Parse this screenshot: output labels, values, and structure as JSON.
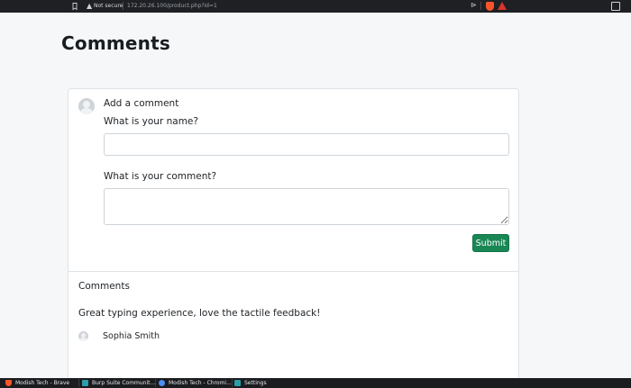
{
  "browser": {
    "security_text": "Not secure",
    "url": "172.20.26.100/product.php?id=1"
  },
  "page": {
    "title": "Comments"
  },
  "form": {
    "add_comment_label": "Add a comment",
    "name_label": "What is your name?",
    "name_value": "",
    "comment_label": "What is your comment?",
    "comment_value": "",
    "submit_label": "Submit"
  },
  "comments": {
    "heading": "Comments",
    "items": [
      {
        "text": "Great typing experience, love the tactile feedback!",
        "author": "Sophia Smith"
      }
    ]
  },
  "taskbar": {
    "items": [
      {
        "label": "Modish Tech - Brave",
        "icon": "brave-icon"
      },
      {
        "label": "Burp Suite Communit...",
        "icon": "burp-suite-icon"
      },
      {
        "label": "Modish Tech - Chromi...",
        "icon": "chromium-icon"
      },
      {
        "label": "Settings",
        "icon": "settings-icon"
      }
    ]
  },
  "colors": {
    "submit_bg": "#198754",
    "brave_orange": "#fb542b",
    "chrome_bg": "#1f2023"
  }
}
